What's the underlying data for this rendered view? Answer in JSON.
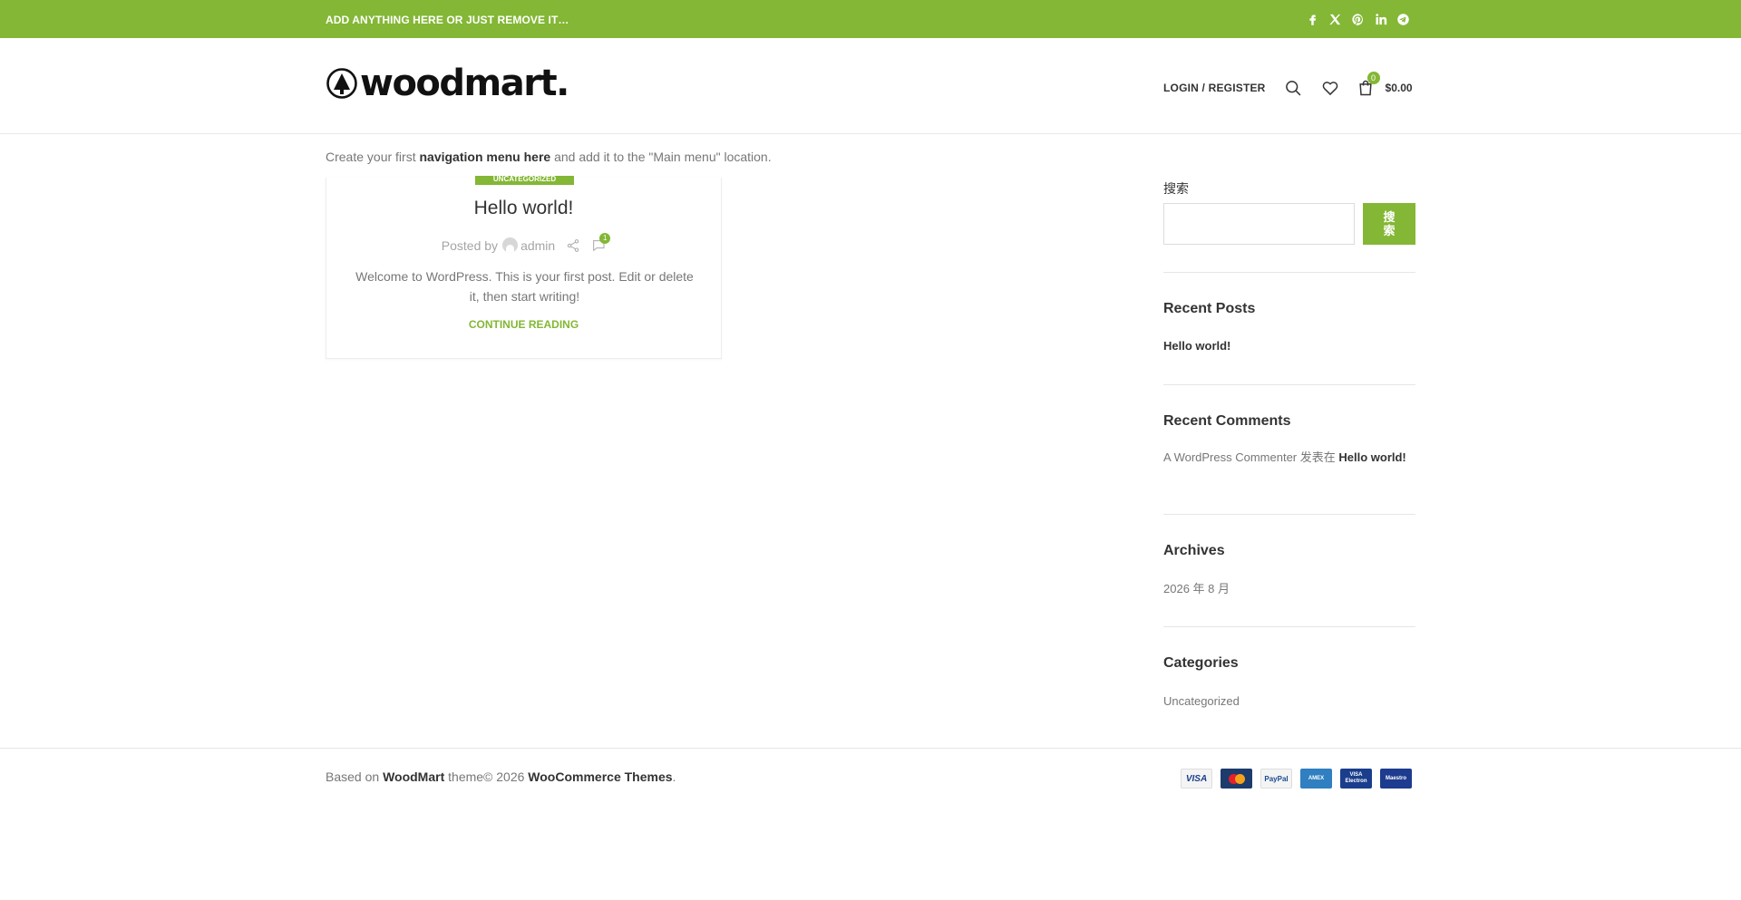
{
  "topbar": {
    "message": "ADD ANYTHING HERE OR JUST REMOVE IT…",
    "social_icons": [
      "facebook-icon",
      "x-icon",
      "pinterest-icon",
      "linkedin-icon",
      "telegram-icon"
    ]
  },
  "header": {
    "logo_text": "woodmart.",
    "login_label": "LOGIN / REGISTER",
    "cart_count": "0",
    "cart_total": "$0.00"
  },
  "nav_notice": {
    "prefix": "Create your first ",
    "link": "navigation menu here",
    "suffix": " and add it to the \"Main menu\" location."
  },
  "post": {
    "category": "UNCATEGORIZED",
    "title": "Hello world!",
    "posted_by": "Posted by",
    "author": "admin",
    "comment_count": "1",
    "excerpt": "Welcome to WordPress. This is your first post. Edit or delete it, then start writing!",
    "read_more": "CONTINUE READING"
  },
  "sidebar": {
    "search_label": "搜索",
    "search_button": "搜索",
    "recent_posts": {
      "title": "Recent Posts",
      "items": [
        "Hello world!"
      ]
    },
    "recent_comments": {
      "title": "Recent Comments",
      "author": "A WordPress Commenter",
      "on": " 发表在 ",
      "post": "Hello world!"
    },
    "archives": {
      "title": "Archives",
      "items": [
        "2026 年 8 月"
      ]
    },
    "categories": {
      "title": "Categories",
      "items": [
        "Uncategorized"
      ]
    }
  },
  "footer": {
    "based_on": "Based on ",
    "theme_name": "WoodMart",
    "theme_mid": " theme© 2026 ",
    "company": "WooCommerce Themes",
    "end": ".",
    "payments": [
      "VISA",
      "MasterCard",
      "PayPal",
      "AMERICAN EXPRESS",
      "VISA Electron",
      "Maestro"
    ]
  },
  "colors": {
    "accent": "#83b735"
  }
}
